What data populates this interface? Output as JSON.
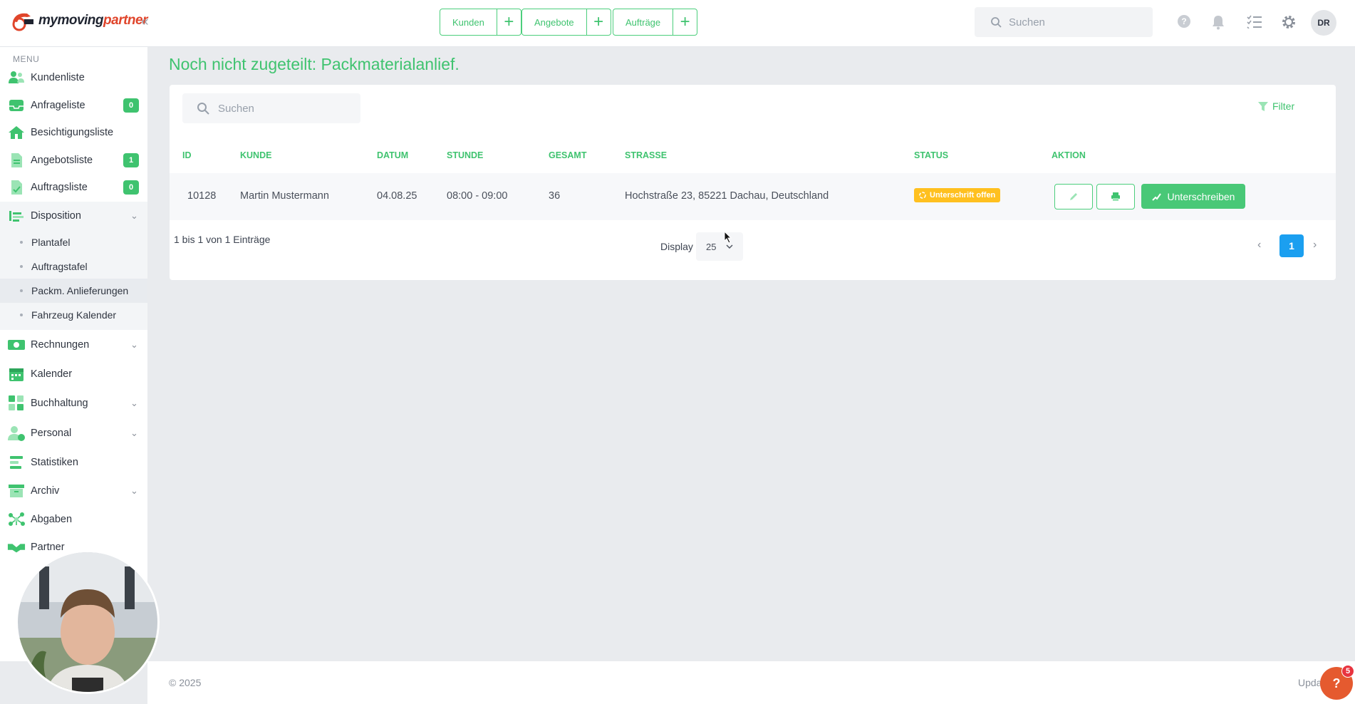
{
  "brand": {
    "logo_part1": "mymoving",
    "logo_part2": "partner",
    "collapse_glyph": "«"
  },
  "quick_actions": [
    {
      "label": "Kunden",
      "plus": "+"
    },
    {
      "label": "Angebote",
      "plus": "+"
    },
    {
      "label": "Aufträge",
      "plus": "+"
    }
  ],
  "top_search": {
    "placeholder": "Suchen"
  },
  "top_icons": [
    "help-circle-icon",
    "bell-icon",
    "checklist-icon",
    "gear-icon"
  ],
  "user": {
    "initials": "DR"
  },
  "sidebar": {
    "menu_caption": "MENU",
    "items": [
      {
        "label": "Kundenliste",
        "icon": "customers-icon"
      },
      {
        "label": "Anfrageliste",
        "icon": "inbox-icon",
        "badge": "0"
      },
      {
        "label": "Besichtigungsliste",
        "icon": "house-icon"
      },
      {
        "label": "Angebotsliste",
        "icon": "offer-document-icon",
        "badge": "1"
      },
      {
        "label": "Auftragsliste",
        "icon": "order-document-icon",
        "badge": "0"
      },
      {
        "label": "Disposition",
        "icon": "disposition-icon",
        "expanded": true,
        "children": [
          {
            "label": "Plantafel"
          },
          {
            "label": "Auftragstafel"
          },
          {
            "label": "Packm. Anlieferungen",
            "active": true
          },
          {
            "label": "Fahrzeug Kalender"
          }
        ]
      },
      {
        "label": "Rechnungen",
        "icon": "invoice-icon"
      },
      {
        "label": "Kalender",
        "icon": "calendar-icon"
      },
      {
        "label": "Buchhaltung",
        "icon": "accounting-icon"
      },
      {
        "label": "Personal",
        "icon": "staff-icon"
      },
      {
        "label": "Statistiken",
        "icon": "statistics-icon"
      },
      {
        "label": "Archiv",
        "icon": "archive-icon"
      },
      {
        "label": "Abgaben",
        "icon": "network-icon"
      },
      {
        "label": "Partner",
        "icon": "handshake-icon"
      }
    ]
  },
  "main": {
    "title": "Noch nicht zugeteilt: Packmaterialanlief.",
    "search_placeholder": "Suchen",
    "filter_label": "Filter",
    "columns": [
      "ID",
      "KUNDE",
      "DATUM",
      "STUNDE",
      "GESAMT",
      "STRASSE",
      "STATUS",
      "AKTION"
    ],
    "rows": [
      {
        "id": "10128",
        "kunde": "Martin Mustermann",
        "datum": "04.08.25",
        "stunde": "08:00 - 09:00",
        "gesamt": "36",
        "strasse": "Hochstraße 23, 85221 Dachau, Deutschland",
        "status": "Unterschrift offen",
        "sign_label": "Unterschreiben"
      }
    ],
    "entries_info": "1 bis 1 von 1 Einträge",
    "display_label": "Display",
    "display_value": "25",
    "pagination": {
      "prev": "‹",
      "current": "1",
      "next": "›"
    }
  },
  "footer": {
    "copyright": "© 2025",
    "right_text": "Upda"
  },
  "help_widget": {
    "label": "?",
    "badge": "5"
  },
  "colors": {
    "accent": "#3fc36f",
    "status_warning": "#ffc01f",
    "pagination_active": "#1b9ff0",
    "help": "#e55a2f"
  }
}
